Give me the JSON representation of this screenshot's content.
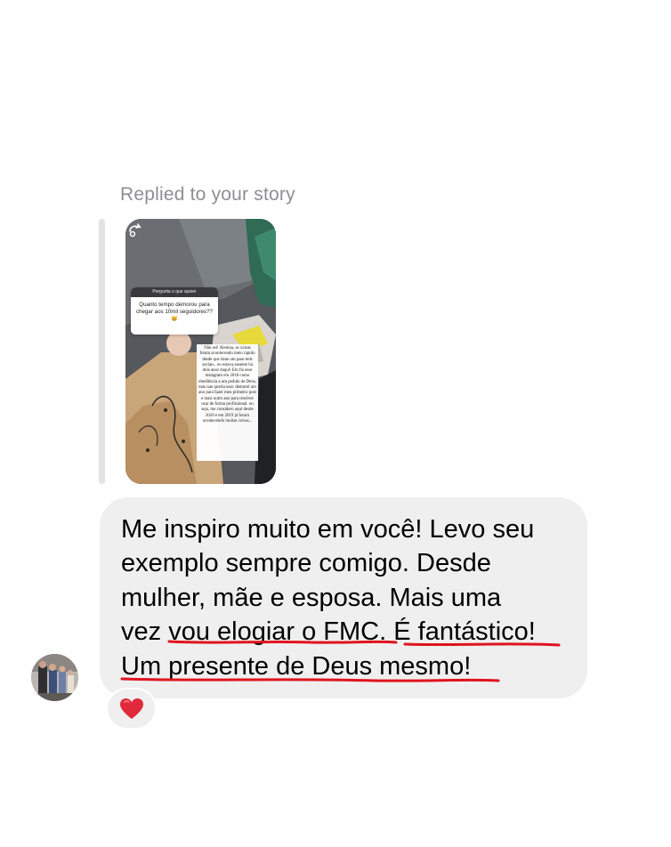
{
  "reply": {
    "label": "Replied to your story"
  },
  "story": {
    "question_header": "Pergunta o que quiser",
    "question_text": "Quanto tempo demorou para chegar aos 10mil seguidores?? 😸",
    "answer_text": "Não sei! Alenina, as coisas foram acontecendo meio rapido desde que dane um pase teds sociais.. eu estava ausente há dois anos daqui! Em fiz esse instagram em 2018 como obediência a um pedido de Deus, mas nao queria usar. demorei um ano para fazer meu primeiro post e mais outro ano para resolver usar de forma profissional. ou seja, me considero aqui desde 2020 e em 2019 já foram acontecendo muitas coisas..."
  },
  "message": {
    "lines": [
      "Me inspiro muito em você! Levo seu",
      "exemplo sempre comigo. Desde",
      "mulher, mãe e esposa. Mais uma",
      "vez vou elogiar o FMC. É fantástico!",
      "Um presente de Deus mesmo!"
    ],
    "line4_prefix": "vez ",
    "line4_highlight_1": "vou elogiar o FMC.",
    "line4_space": " ",
    "line4_highlight_2": "É fantástico!",
    "line5_highlight": "Um presente de Deus mesmo!"
  },
  "reaction": {
    "icon": "red-heart-icon",
    "emoji": "❤️"
  },
  "colors": {
    "bubble": "#efefef",
    "meta_text": "#8e8e93",
    "underline": "#e0141e",
    "heart": "#e02a3b"
  }
}
